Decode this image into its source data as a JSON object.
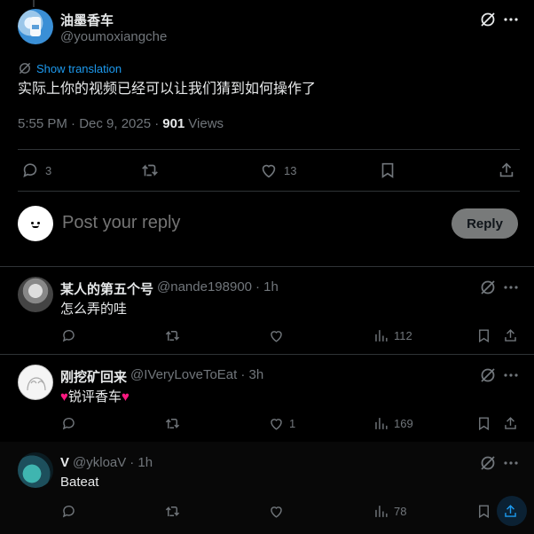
{
  "main_tweet": {
    "author_name": "油墨香车",
    "author_handle": "@youmoxiangche",
    "show_translation": "Show translation",
    "text": "实际上你的视频已经可以让我们猜到如何操作了",
    "time": "5:55 PM · Dec 9, 2025 ·",
    "views_count": "901",
    "views_label": "Views",
    "reply_count": "3",
    "like_count": "13"
  },
  "reply_box": {
    "placeholder": "Post your reply",
    "button": "Reply"
  },
  "replies": [
    {
      "name": "某人的第五个号",
      "handle": "@nande198900",
      "time": "· 1h",
      "text": "怎么弄的哇",
      "reply_count": "",
      "retweet_count": "",
      "like_count": "",
      "views": "112"
    },
    {
      "name": "刚挖矿回来",
      "handle": "@IVeryLoveToEat",
      "time": "· 3h",
      "text": "♥锐评香车♥",
      "reply_count": "",
      "retweet_count": "",
      "like_count": "1",
      "views": "169"
    },
    {
      "name": "V",
      "handle": "@ykloaV",
      "time": "· 1h",
      "text": "Bateat",
      "reply_count": "",
      "retweet_count": "",
      "like_count": "",
      "views": "78"
    }
  ],
  "colors": {
    "background": "#000000",
    "text": "#e7e9ea",
    "muted": "#71767b",
    "link": "#1d9bf0",
    "border": "#2f3336",
    "reply_button": "#787a7a",
    "heart": "#f91880"
  },
  "icons": [
    "grok-icon",
    "more-icon",
    "translate-icon",
    "reply-icon",
    "retweet-icon",
    "like-icon",
    "views-icon",
    "bookmark-icon",
    "share-icon"
  ]
}
